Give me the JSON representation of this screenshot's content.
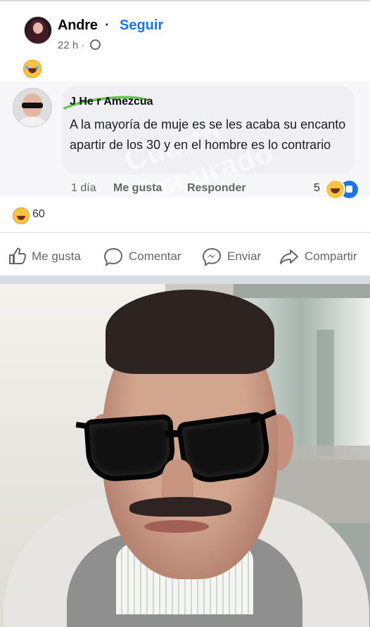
{
  "post": {
    "author": "Andre",
    "separator": "·",
    "follow": "Seguir",
    "time": "22 h ·",
    "reaction_icon": "laugh-emoji"
  },
  "comment": {
    "author": "J He  r Amezcua",
    "text": "A la mayoría de muje  es se les acaba su encanto apartir de los 30 y en el hombre es lo contrario",
    "watermark": "Cuarto Oscurado",
    "time": "1 día",
    "like": "Me gusta",
    "reply": "Responder",
    "reaction_count": "5"
  },
  "reactions": {
    "total": "60"
  },
  "actions": {
    "like": "Me gusta",
    "comment": "Comentar",
    "send": "Enviar",
    "share": "Compartir"
  },
  "colors": {
    "link_blue": "#1b74e4",
    "secondary_text": "#65676b",
    "highlight_green": "#64c84f"
  }
}
